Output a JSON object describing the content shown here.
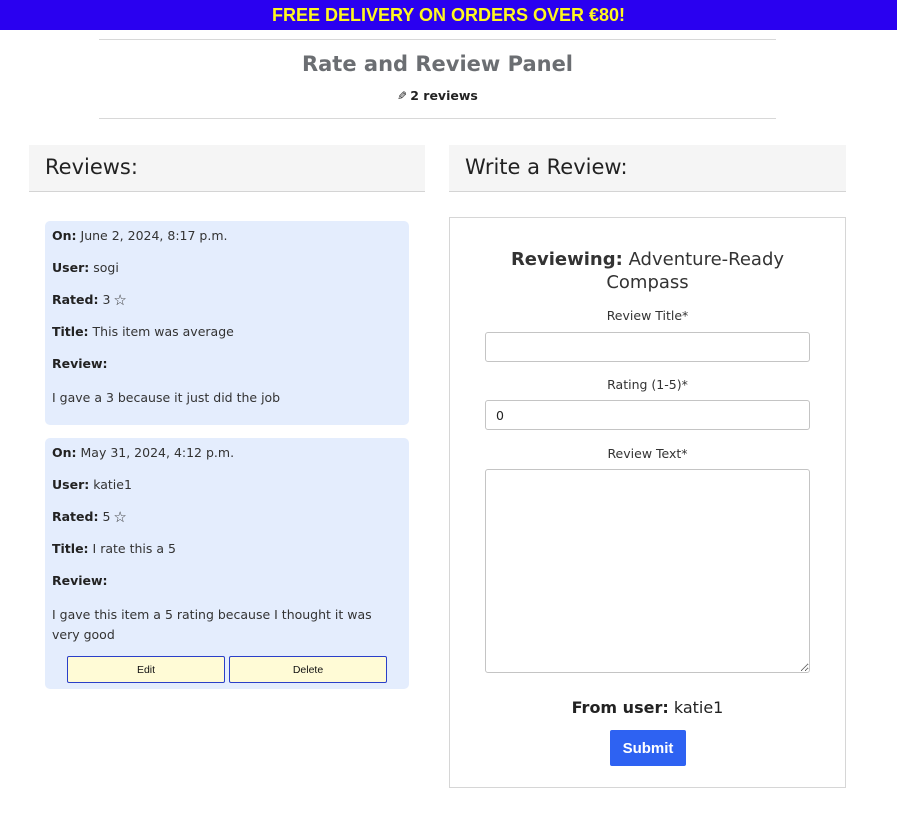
{
  "banner": {
    "text": "FREE DELIVERY ON ORDERS OVER €80!"
  },
  "panel": {
    "title": "Rate and Review Panel",
    "count": "2 reviews",
    "icon": "pencil-icon"
  },
  "reviews_section": {
    "heading": "Reviews:",
    "labels": {
      "on": "On:",
      "user": "User:",
      "rated": "Rated:",
      "title": "Title:",
      "review": "Review:"
    },
    "items": [
      {
        "on": "June 2, 2024, 8:17 p.m.",
        "user": "sogi",
        "rating": "3",
        "title": "This item was average",
        "review": "I gave a 3 because it just did the job"
      },
      {
        "on": "May 31, 2024, 4:12 p.m.",
        "user": "katie1",
        "rating": "5",
        "title": "I rate this a 5",
        "review": "I gave this item a 5 rating because I thought it was very good"
      }
    ],
    "edit_label": "Edit",
    "delete_label": "Delete"
  },
  "write_section": {
    "heading": "Write a Review:",
    "reviewing_label": "Reviewing:",
    "product_name": "Adventure-Ready Compass",
    "title_label": "Review Title*",
    "title_value": "",
    "rating_label": "Rating (1-5)*",
    "rating_value": "0",
    "text_label": "Review Text*",
    "from_user_label": "From user:",
    "from_user_value": "katie1",
    "submit_label": "Submit"
  },
  "colors": {
    "banner_bg": "#2a00f0",
    "banner_text": "#fff820",
    "card_bg": "#e4edfd",
    "submit_bg": "#2e62f2",
    "button_bg": "#fffbd6"
  }
}
